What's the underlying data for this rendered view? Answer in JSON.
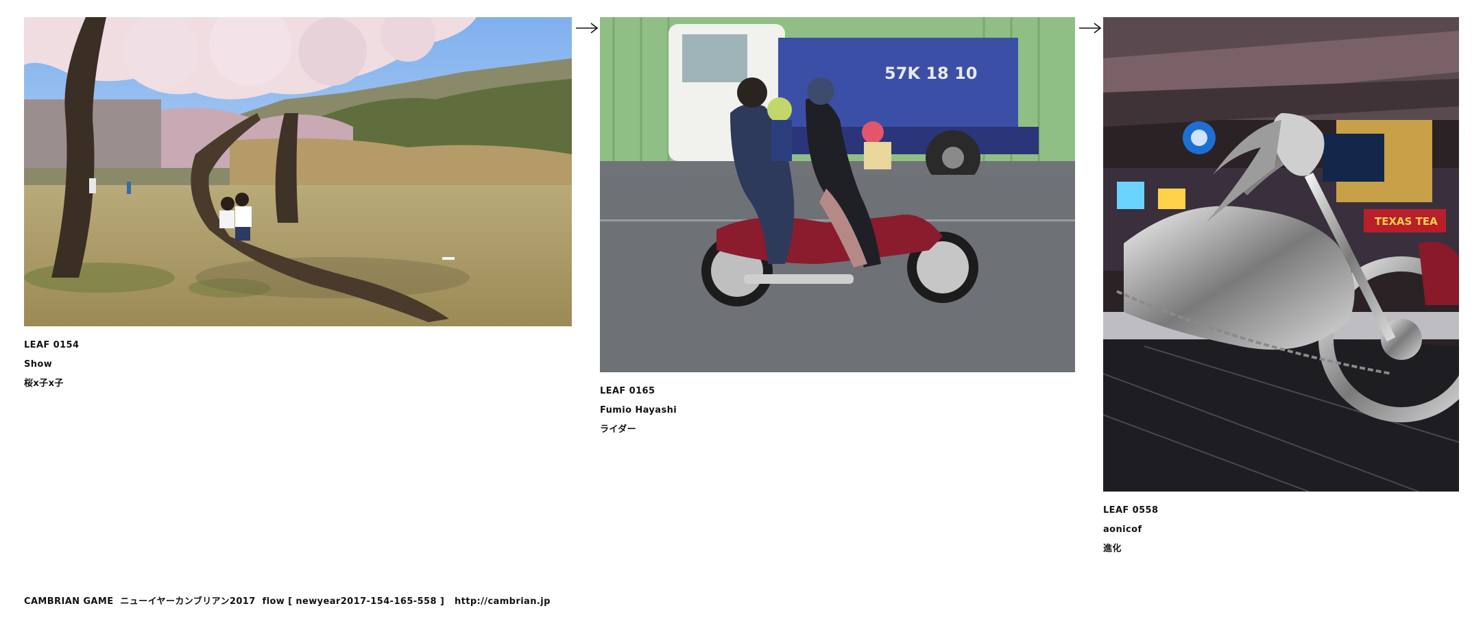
{
  "leaves": [
    {
      "number": "LEAF 0154",
      "author": "Show",
      "title": "桜x子x子",
      "image_icon": "cherry-blossom-park-photo"
    },
    {
      "number": "LEAF 0165",
      "author": "Fumio Hayashi",
      "title": "ライダー",
      "image_icon": "family-motorbike-photo",
      "truck_plate": "57K  18 10"
    },
    {
      "number": "LEAF 0558",
      "author": "aonicof",
      "title": "進化",
      "image_icon": "chrome-motorcycle-sculpture-photo",
      "sign_text": "TEXAS TEA"
    }
  ],
  "flow_arrow": "→",
  "footer": {
    "brand": "CAMBRIAN GAME",
    "event": "ニューイヤーカンブリアン2017",
    "flow_label": "flow [ newyear2017-154-165-558 ]",
    "url": "http://cambrian.jp"
  },
  "colors": {
    "text": "#111111",
    "background": "#ffffff"
  }
}
